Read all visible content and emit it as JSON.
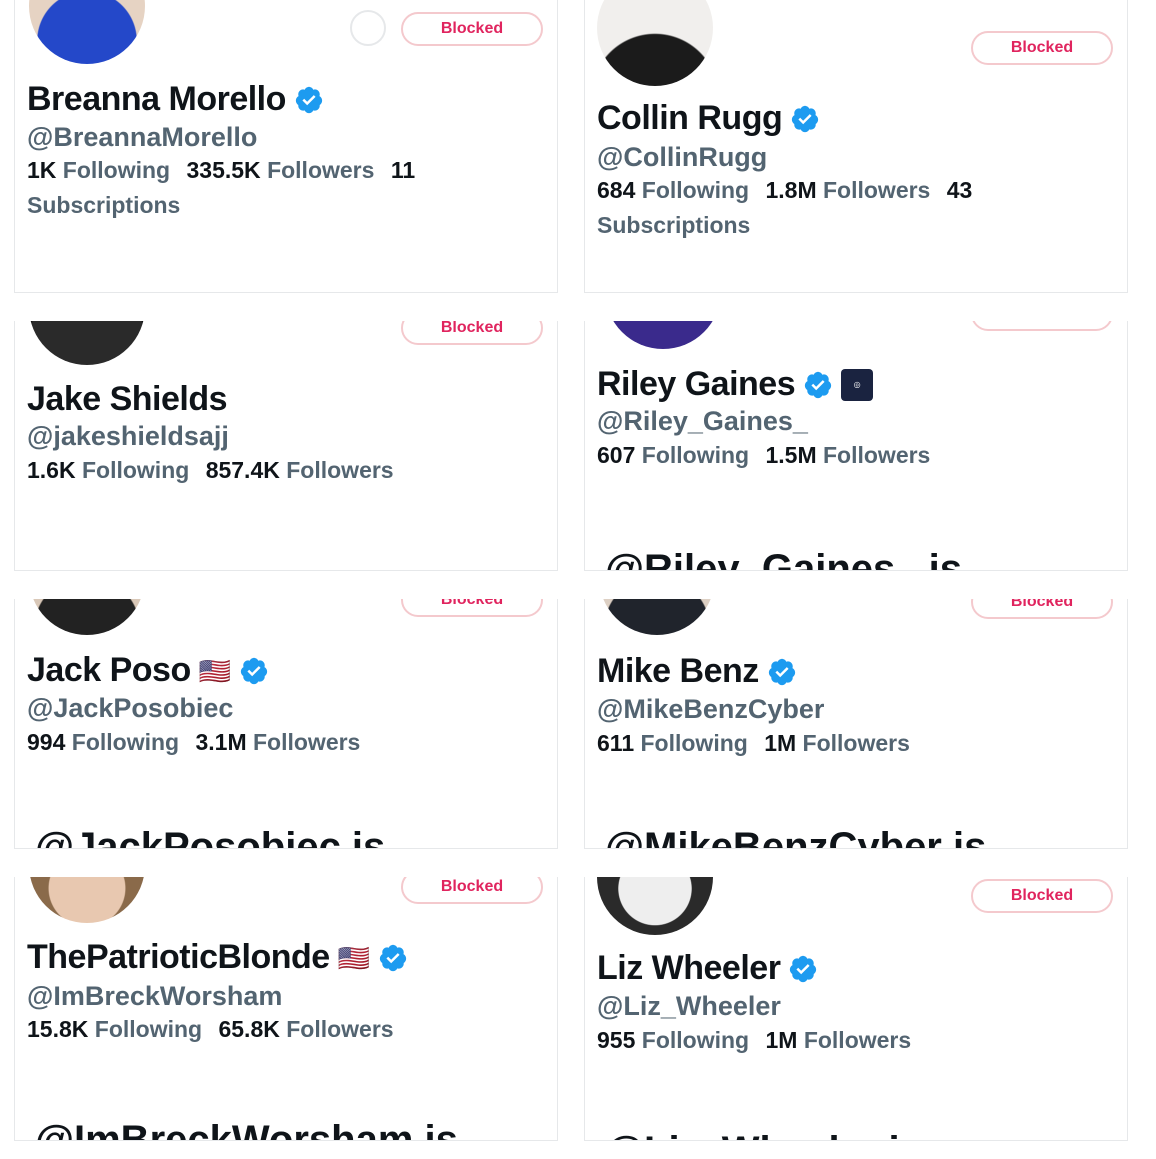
{
  "blocked_label": "Blocked",
  "cards": [
    {
      "name": "Breanna Morello",
      "handle": "@BreannaMorello",
      "following": "1K",
      "followers": "335.5K",
      "subscriptions": "11"
    },
    {
      "name": "Collin Rugg",
      "handle": "@CollinRugg",
      "following": "684",
      "followers": "1.8M",
      "subscriptions": "43"
    },
    {
      "name": "Jake Shields",
      "handle": "@jakeshieldsajj",
      "following": "1.6K",
      "followers": "857.4K"
    },
    {
      "name": "Riley Gaines",
      "handle": "@Riley_Gaines_",
      "following": "607",
      "followers": "1.5M",
      "cutoff": "@Riley_Gaines_ is"
    },
    {
      "name": "Jack Poso",
      "flag": "🇺🇸",
      "handle": "@JackPosobiec",
      "following": "994",
      "followers": "3.1M",
      "cutoff": "@JackPosobiec is"
    },
    {
      "name": "Mike Benz",
      "handle": "@MikeBenzCyber",
      "following": "611",
      "followers": "1M",
      "cutoff": "@MikeBenzCyber is"
    },
    {
      "name": "ThePatrioticBlonde",
      "flag": "🇺🇸",
      "handle": "@ImBreckWorsham",
      "following": "15.8K",
      "followers": "65.8K",
      "cutoff": "@ImBreckWorsham is"
    },
    {
      "name": "Liz Wheeler",
      "handle": "@Liz_Wheeler",
      "following": "955",
      "followers": "1M",
      "cutoff": "@Liz_Wheeler is"
    }
  ],
  "labels": {
    "following": "Following",
    "followers": "Followers",
    "subscriptions": "Subscriptions"
  },
  "colors": {
    "verified": "#1d9bf0",
    "blocked": "#e0245e",
    "muted": "#536471"
  }
}
